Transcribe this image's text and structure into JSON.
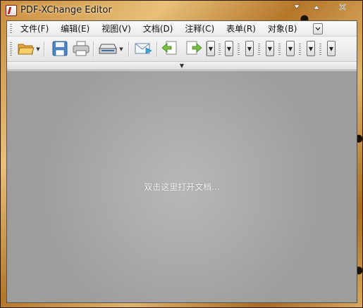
{
  "window": {
    "title": "PDF-XChange Editor"
  },
  "menu": {
    "items": [
      {
        "label": "文件(F)"
      },
      {
        "label": "编辑(E)"
      },
      {
        "label": "视图(V)"
      },
      {
        "label": "文档(D)"
      },
      {
        "label": "注释(C)"
      },
      {
        "label": "表单(R)"
      },
      {
        "label": "对象(B)"
      }
    ]
  },
  "toolbar": {
    "icons": [
      "open-folder-icon",
      "save-icon",
      "print-icon",
      "scanner-icon",
      "email-icon",
      "back-icon",
      "forward-icon"
    ],
    "combo_count": 7
  },
  "document": {
    "hint": "双击这里打开文档..."
  },
  "colors": {
    "accent_red": "#c21f1f",
    "doc_background": "#a3a3a3"
  }
}
